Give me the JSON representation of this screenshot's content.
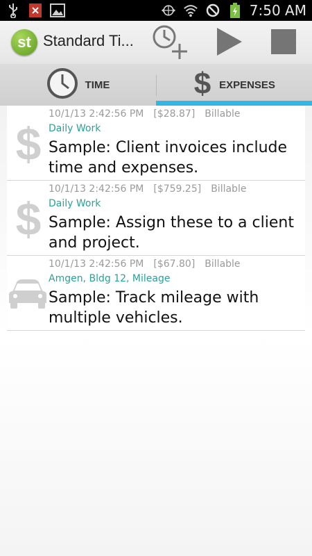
{
  "status_bar": {
    "time": "7:50 AM",
    "icons": [
      "usb-icon",
      "notification-x-icon",
      "image-icon",
      "data-sync-icon",
      "wifi-icon",
      "do-not-disturb-icon",
      "battery-charging-icon"
    ]
  },
  "action_bar": {
    "logo_text": "st",
    "title": "Standard Ti...",
    "buttons": [
      "add-time-icon",
      "play-icon",
      "stop-icon"
    ]
  },
  "tabs": [
    {
      "label": "TIME",
      "icon": "clock-icon",
      "selected": false
    },
    {
      "label": "EXPENSES",
      "icon": "dollar-icon",
      "selected": true
    }
  ],
  "colors": {
    "accent": "#33b5e5",
    "category": "#2aa198",
    "meta": "#9a9a9a"
  },
  "expenses": [
    {
      "datetime": "10/1/13 2:42:56 PM",
      "amount": "[$28.87]",
      "billable": "Billable",
      "category": "Daily Work",
      "description": "Sample: Client invoices include time and expenses.",
      "icon": "dollar-icon"
    },
    {
      "datetime": "10/1/13 2:42:56 PM",
      "amount": "[$759.25]",
      "billable": "Billable",
      "category": "Daily Work",
      "description": "Sample: Assign these to a client and project.",
      "icon": "dollar-icon"
    },
    {
      "datetime": "10/1/13 2:42:56 PM",
      "amount": "[$67.80]",
      "billable": "Billable",
      "category": "Amgen, Bldg 12, Mileage",
      "description": "Sample: Track mileage with multiple vehicles.",
      "icon": "car-icon"
    }
  ]
}
